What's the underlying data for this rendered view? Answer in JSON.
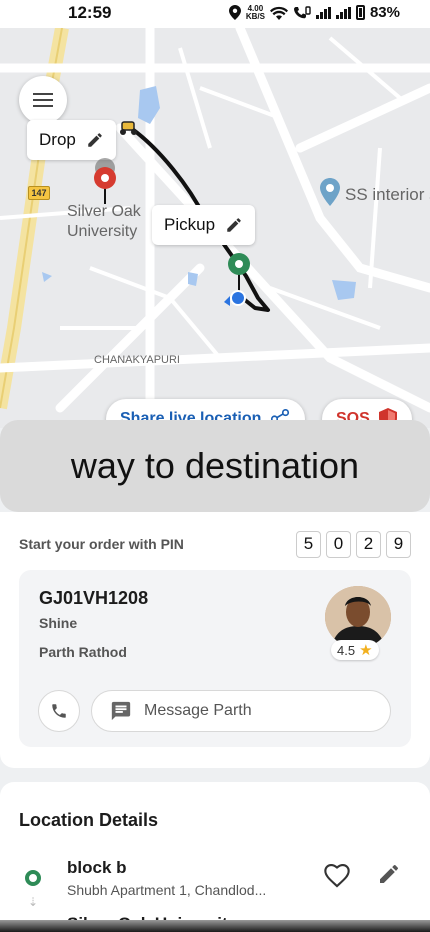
{
  "status_bar": {
    "time": "12:59",
    "speed_value": "4.00",
    "speed_unit": "KB/S",
    "battery": "83%"
  },
  "map": {
    "drop_label": "Drop",
    "pickup_label": "Pickup",
    "university_label_line1": "Silver Oak",
    "university_label_line2": "University",
    "poi_label": "SS interior s",
    "area_label": "CHANAKYAPURI",
    "road_number": "147",
    "share_label": "Share live location",
    "sos_label": "SOS"
  },
  "toast": {
    "text": "way to destination"
  },
  "order": {
    "pin_label": "Start your order with PIN",
    "pin_digits": [
      "5",
      "0",
      "2",
      "9"
    ],
    "vehicle_plate": "GJ01VH1208",
    "vehicle_model": "Shine",
    "driver_name": "Parth Rathod",
    "rating": "4.5",
    "message_placeholder": "Message Parth"
  },
  "location": {
    "title": "Location Details",
    "items": [
      {
        "name": "block b",
        "address": "Shubh Apartment 1, Chandlod..."
      },
      {
        "name": "Silver Oak University",
        "address": ""
      }
    ]
  },
  "colors": {
    "accent_blue": "#1a5fb4",
    "sos_red": "#d0342c",
    "pickup_green": "#2e8b57",
    "drop_red": "#d63b30"
  }
}
